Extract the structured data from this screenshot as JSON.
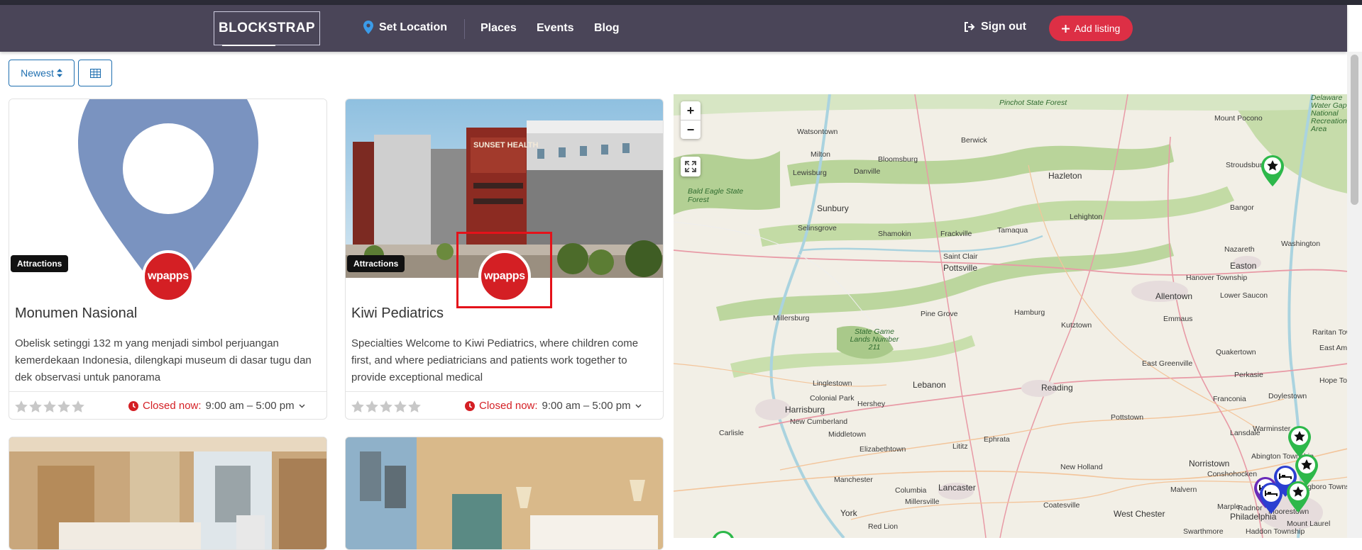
{
  "navbar": {
    "brand": "BLOCKSTRAP",
    "set_location": "Set Location",
    "links": [
      "Places",
      "Events",
      "Blog"
    ],
    "sign_out": "Sign out",
    "add_listing": "Add listing"
  },
  "toolbar": {
    "sort_label": "Newest"
  },
  "listings": [
    {
      "category": "Attractions",
      "logo_text": "wpapps",
      "title": "Monumen Nasional",
      "description": "Obelisk setinggi 132 m yang menjadi simbol perjuangan kemerdekaan Indonesia, dilengkapi museum di dasar tugu dan dek observasi untuk panorama",
      "rating": 0,
      "closed_label": "Closed now:",
      "hours": "9:00 am – 5:00 pm"
    },
    {
      "category": "Attractions",
      "logo_text": "wpapps",
      "title": "Kiwi Pediatrics",
      "description": "Specialties Welcome to Kiwi Pediatrics, where children come first, and where pediatricians and patients work together to provide exceptional medical",
      "rating": 0,
      "closed_label": "Closed now:",
      "hours": "9:00 am – 5:00 pm",
      "building_sign": "SUNSET HEALTH"
    }
  ],
  "map": {
    "zoom_in": "+",
    "zoom_out": "−",
    "places": [
      "Pinchot State Forest",
      "Mount Pocono",
      "Watsontown",
      "Berwick",
      "Milton",
      "Bloomsburg",
      "Danville",
      "Lewisburg",
      "Hazleton",
      "Stroudsburg",
      "Bald Eagle State Forest",
      "Sunbury",
      "Bangor",
      "Selinsgrove",
      "Shamokin",
      "Frackville",
      "Tamaqua",
      "Lehighton",
      "Nazareth",
      "Saint Clair",
      "Washington",
      "Pottsville",
      "Easton",
      "Hanover Township",
      "Allentown",
      "Lower Saucon",
      "Millersburg",
      "Pine Grove",
      "Hamburg",
      "Emmaus",
      "Kutztown",
      "State Game Lands Number 211",
      "Quakertown",
      "Raritan Towns",
      "Linglestown",
      "Lebanon",
      "East Greenville",
      "Perkasie",
      "Colonial Park",
      "Reading",
      "Doylestown",
      "Harrisburg",
      "Hershey",
      "Franconia",
      "New Cumberland",
      "Carlisle",
      "Middletown",
      "Ephrata",
      "Pottstown",
      "Lansdale",
      "Warminster",
      "Elizabethtown",
      "Lititz",
      "Norristown",
      "Abington Township",
      "Conshohocken",
      "New Holland",
      "Malvern",
      "Manchester",
      "Lancaster",
      "Columbia",
      "Millersville",
      "Coatesville",
      "West Chester",
      "Marple",
      "Radnor",
      "York",
      "Red Lion",
      "Philadelphia",
      "Moorestown",
      "Haddon Township",
      "Swarthmore",
      "Mount Laurel",
      "Delaware Water Gap National Recreation Area",
      "Willingboro Township",
      "East Am",
      "Hope Tow"
    ]
  },
  "colors": {
    "navbar_bg": "#4a4558",
    "accent_red": "#dd2f45",
    "link_blue": "#1f6fb0",
    "logo_red": "#d41f24",
    "marker_green": "#2db84a",
    "marker_purple": "#6a2bb8",
    "marker_blue": "#2b3fd1"
  },
  "icons": [
    "map-pin-icon",
    "sign-out-icon",
    "plus-icon",
    "sort-icon",
    "grid-icon",
    "star-icon",
    "clock-icon",
    "chevron-down-icon",
    "fullscreen-icon",
    "map-marker-star-icon",
    "map-marker-bed-icon"
  ]
}
